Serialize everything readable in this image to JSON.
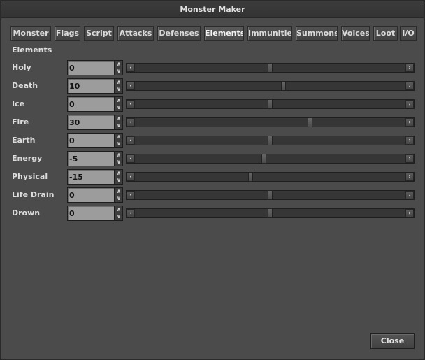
{
  "window": {
    "title": "Monster Maker"
  },
  "tabs": [
    {
      "label": "Monster"
    },
    {
      "label": "Flags"
    },
    {
      "label": "Script"
    },
    {
      "label": "Attacks"
    },
    {
      "label": "Defenses"
    },
    {
      "label": "Elements",
      "active": true
    },
    {
      "label": "Immunities"
    },
    {
      "label": "Summons"
    },
    {
      "label": "Voices"
    },
    {
      "label": "Loot"
    },
    {
      "label": "I/O"
    }
  ],
  "section": {
    "title": "Elements"
  },
  "elements": {
    "slider_range": [
      -100,
      100
    ],
    "rows": [
      {
        "label": "Holy",
        "value": "0"
      },
      {
        "label": "Death",
        "value": "10"
      },
      {
        "label": "Ice",
        "value": "0"
      },
      {
        "label": "Fire",
        "value": "30"
      },
      {
        "label": "Earth",
        "value": "0"
      },
      {
        "label": "Energy",
        "value": "-5"
      },
      {
        "label": "Physical",
        "value": "-15"
      },
      {
        "label": "Life Drain",
        "value": "0"
      },
      {
        "label": "Drown",
        "value": "0"
      }
    ]
  },
  "icons": {
    "spin_up": "chevron-up-icon",
    "spin_down": "chevron-down-icon",
    "scroll_left": "chevron-left-icon",
    "scroll_right": "chevron-right-icon"
  },
  "footer": {
    "close_label": "Close"
  }
}
